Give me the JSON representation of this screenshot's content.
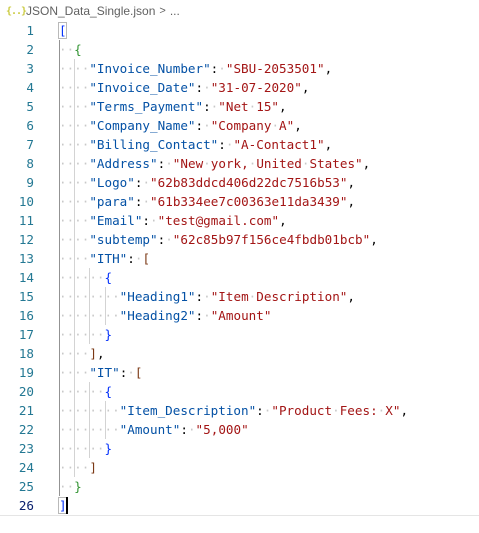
{
  "breadcrumb": {
    "icon": "{..}",
    "filename": "JSON_Data_Single.json",
    "separator": ">",
    "ellipsis": "..."
  },
  "editor": {
    "active_line": 26,
    "lines": [
      {
        "n": "1",
        "indent": 0,
        "tokens": [
          {
            "t": "[",
            "c": "br1"
          }
        ]
      },
      {
        "n": "2",
        "indent": 1,
        "tokens": [
          {
            "t": "{",
            "c": "br2"
          }
        ]
      },
      {
        "n": "3",
        "indent": 2,
        "tokens": [
          {
            "t": "\"Invoice_Number\"",
            "c": "key"
          },
          {
            "t": ":",
            "c": "punc"
          },
          {
            "t": " ",
            "c": "ws"
          },
          {
            "t": "\"SBU-2053501\"",
            "c": "str"
          },
          {
            "t": ",",
            "c": "punc"
          }
        ]
      },
      {
        "n": "4",
        "indent": 2,
        "tokens": [
          {
            "t": "\"Invoice_Date\"",
            "c": "key"
          },
          {
            "t": ":",
            "c": "punc"
          },
          {
            "t": " ",
            "c": "ws"
          },
          {
            "t": "\"31-07-2020\"",
            "c": "str"
          },
          {
            "t": ",",
            "c": "punc"
          }
        ]
      },
      {
        "n": "5",
        "indent": 2,
        "tokens": [
          {
            "t": "\"Terms_Payment\"",
            "c": "key"
          },
          {
            "t": ":",
            "c": "punc"
          },
          {
            "t": " ",
            "c": "ws"
          },
          {
            "t": "\"Net 15\"",
            "c": "str"
          },
          {
            "t": ",",
            "c": "punc"
          }
        ]
      },
      {
        "n": "6",
        "indent": 2,
        "tokens": [
          {
            "t": "\"Company_Name\"",
            "c": "key"
          },
          {
            "t": ":",
            "c": "punc"
          },
          {
            "t": " ",
            "c": "ws"
          },
          {
            "t": "\"Company A\"",
            "c": "str"
          },
          {
            "t": ",",
            "c": "punc"
          }
        ]
      },
      {
        "n": "7",
        "indent": 2,
        "tokens": [
          {
            "t": "\"Billing_Contact\"",
            "c": "key"
          },
          {
            "t": ":",
            "c": "punc"
          },
          {
            "t": " ",
            "c": "ws"
          },
          {
            "t": "\"A-Contact1\"",
            "c": "str"
          },
          {
            "t": ",",
            "c": "punc"
          }
        ]
      },
      {
        "n": "8",
        "indent": 2,
        "tokens": [
          {
            "t": "\"Address\"",
            "c": "key"
          },
          {
            "t": ":",
            "c": "punc"
          },
          {
            "t": " ",
            "c": "ws"
          },
          {
            "t": "\"New york, United States\"",
            "c": "str"
          },
          {
            "t": ",",
            "c": "punc"
          }
        ]
      },
      {
        "n": "9",
        "indent": 2,
        "tokens": [
          {
            "t": "\"Logo\"",
            "c": "key"
          },
          {
            "t": ":",
            "c": "punc"
          },
          {
            "t": " ",
            "c": "ws"
          },
          {
            "t": "\"62b83ddcd406d22dc7516b53\"",
            "c": "str"
          },
          {
            "t": ",",
            "c": "punc"
          }
        ]
      },
      {
        "n": "10",
        "indent": 2,
        "tokens": [
          {
            "t": "\"para\"",
            "c": "key"
          },
          {
            "t": ":",
            "c": "punc"
          },
          {
            "t": " ",
            "c": "ws"
          },
          {
            "t": "\"61b334ee7c00363e11da3439\"",
            "c": "str"
          },
          {
            "t": ",",
            "c": "punc"
          }
        ]
      },
      {
        "n": "11",
        "indent": 2,
        "tokens": [
          {
            "t": "\"Email\"",
            "c": "key"
          },
          {
            "t": ":",
            "c": "punc"
          },
          {
            "t": " ",
            "c": "ws"
          },
          {
            "t": "\"test@gmail.com\"",
            "c": "str"
          },
          {
            "t": ",",
            "c": "punc"
          }
        ]
      },
      {
        "n": "12",
        "indent": 2,
        "tokens": [
          {
            "t": "\"subtemp\"",
            "c": "key"
          },
          {
            "t": ":",
            "c": "punc"
          },
          {
            "t": " ",
            "c": "ws"
          },
          {
            "t": "\"62c85b97f156ce4fbdb01bcb\"",
            "c": "str"
          },
          {
            "t": ",",
            "c": "punc"
          }
        ]
      },
      {
        "n": "13",
        "indent": 2,
        "tokens": [
          {
            "t": "\"ITH\"",
            "c": "key"
          },
          {
            "t": ":",
            "c": "punc"
          },
          {
            "t": " ",
            "c": "ws"
          },
          {
            "t": "[",
            "c": "br3"
          }
        ]
      },
      {
        "n": "14",
        "indent": 3,
        "tokens": [
          {
            "t": "{",
            "c": "br1"
          }
        ]
      },
      {
        "n": "15",
        "indent": 4,
        "tokens": [
          {
            "t": "\"Heading1\"",
            "c": "key"
          },
          {
            "t": ":",
            "c": "punc"
          },
          {
            "t": " ",
            "c": "ws"
          },
          {
            "t": "\"Item Description\"",
            "c": "str"
          },
          {
            "t": ",",
            "c": "punc"
          }
        ]
      },
      {
        "n": "16",
        "indent": 4,
        "tokens": [
          {
            "t": "\"Heading2\"",
            "c": "key"
          },
          {
            "t": ":",
            "c": "punc"
          },
          {
            "t": " ",
            "c": "ws"
          },
          {
            "t": "\"Amount\"",
            "c": "str"
          }
        ]
      },
      {
        "n": "17",
        "indent": 3,
        "tokens": [
          {
            "t": "}",
            "c": "br1"
          }
        ]
      },
      {
        "n": "18",
        "indent": 2,
        "tokens": [
          {
            "t": "]",
            "c": "br3"
          },
          {
            "t": ",",
            "c": "punc"
          }
        ]
      },
      {
        "n": "19",
        "indent": 2,
        "tokens": [
          {
            "t": "\"IT\"",
            "c": "key"
          },
          {
            "t": ":",
            "c": "punc"
          },
          {
            "t": " ",
            "c": "ws"
          },
          {
            "t": "[",
            "c": "br3"
          }
        ]
      },
      {
        "n": "20",
        "indent": 3,
        "tokens": [
          {
            "t": "{",
            "c": "br1"
          }
        ]
      },
      {
        "n": "21",
        "indent": 4,
        "tokens": [
          {
            "t": "\"Item_Description\"",
            "c": "key"
          },
          {
            "t": ":",
            "c": "punc"
          },
          {
            "t": " ",
            "c": "ws"
          },
          {
            "t": "\"Product Fees: X\"",
            "c": "str"
          },
          {
            "t": ",",
            "c": "punc"
          }
        ]
      },
      {
        "n": "22",
        "indent": 4,
        "tokens": [
          {
            "t": "\"Amount\"",
            "c": "key"
          },
          {
            "t": ":",
            "c": "punc"
          },
          {
            "t": " ",
            "c": "ws"
          },
          {
            "t": "\"5,000\"",
            "c": "str"
          }
        ]
      },
      {
        "n": "23",
        "indent": 3,
        "tokens": [
          {
            "t": "}",
            "c": "br1"
          }
        ]
      },
      {
        "n": "24",
        "indent": 2,
        "tokens": [
          {
            "t": "]",
            "c": "br3"
          }
        ]
      },
      {
        "n": "25",
        "indent": 1,
        "tokens": [
          {
            "t": "}",
            "c": "br2"
          }
        ]
      },
      {
        "n": "26",
        "indent": 0,
        "tokens": [
          {
            "t": "]",
            "c": "br1"
          }
        ]
      }
    ]
  }
}
